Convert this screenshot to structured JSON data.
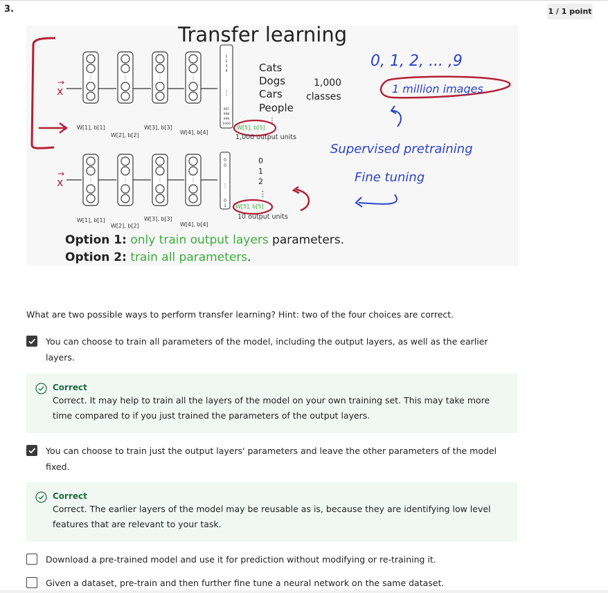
{
  "question": {
    "number": "3.",
    "points": "1 / 1 point",
    "text": "What are two possible ways to perform transfer learning? Hint: two of the four choices are correct."
  },
  "figure": {
    "title": "Transfer learning",
    "input_label": "x",
    "top_classes": [
      "Cats",
      "Dogs",
      "Cars",
      "People"
    ],
    "class_count_line1": "1,000",
    "class_count_line2": "classes",
    "top_output_label": "1,000 output units",
    "bottom_output_label": "10 output units",
    "bottom_digits": [
      "0",
      "1",
      "2",
      "⋮"
    ],
    "top_weight_labels": [
      "W[1], b[1]",
      "W[2], b[2]",
      "W[3], b[3]",
      "W[4], b[4]",
      "W[5], b[5]"
    ],
    "bottom_weight_labels": [
      "W[1], b[1]",
      "W[2], b[2]",
      "W[3], b[3]",
      "W[4], b[4]",
      "W[5], b[5]"
    ],
    "annotation_digits": "0, 1, 2, ... ,9",
    "annotation_million": "1 million images",
    "annotation_pretraining": "Supervised pretraining",
    "annotation_finetuning": "Fine tuning",
    "option1_prefix": "Option 1:",
    "option1_green": "only train output layers",
    "option1_suffix": " parameters.",
    "option2_prefix": "Option 2:",
    "option2_green": "train all parameters",
    "option2_suffix": ".",
    "ink_color": "#b32035",
    "annotation_color": "#2c44c8",
    "green_color": "#3daa3d"
  },
  "options": [
    {
      "text": "You can choose to train all parameters of the model, including the output layers, as well as the earlier layers.",
      "checked": true
    },
    {
      "text": "You can choose to train just the output layers' parameters and leave the other parameters of the model fixed.",
      "checked": true
    },
    {
      "text": "Download a pre-trained model and use it for prediction without modifying or re-training it.",
      "checked": false
    },
    {
      "text": "Given a dataset, pre-train and then further fine tune a neural network on the same dataset.",
      "checked": false
    }
  ],
  "feedback": [
    {
      "title": "Correct",
      "text": "Correct. It may help to train all the layers of the model on your own training set. This may take more time compared to if you just trained the parameters of the output layers."
    },
    {
      "title": "Correct",
      "text": "Correct. The earlier layers of the model may be reusable as is, because they are identifying low level features that are relevant to your task."
    }
  ]
}
